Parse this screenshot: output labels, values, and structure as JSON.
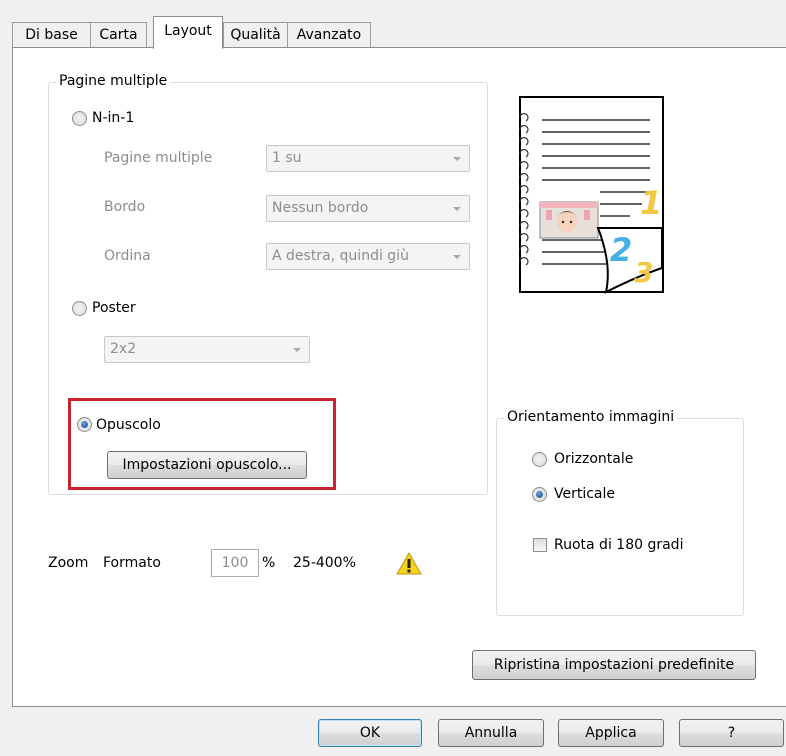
{
  "tabs": [
    "Di base",
    "Carta",
    "Layout",
    "Qualità",
    "Avanzato"
  ],
  "active_tab": "Layout",
  "pagine_multiple": {
    "legend": "Pagine multiple",
    "nin1": {
      "label": "N-in-1",
      "checked": false,
      "pagine_label": "Pagine multiple",
      "pagine_value": "1 su",
      "bordo_label": "Bordo",
      "bordo_value": "Nessun bordo",
      "ordina_label": "Ordina",
      "ordina_value": "A destra, quindi giù"
    },
    "poster": {
      "label": "Poster",
      "checked": false,
      "value": "2x2"
    },
    "opuscolo": {
      "label": "Opuscolo",
      "checked": true,
      "button": "Impostazioni opuscolo...",
      "highlight_color": "#c8232c"
    }
  },
  "orientamento": {
    "legend": "Orientamento immagini",
    "orizzontale": {
      "label": "Orizzontale",
      "checked": false
    },
    "verticale": {
      "label": "Verticale",
      "checked": true
    },
    "ruota": {
      "label": "Ruota di 180 gradi",
      "checked": false
    }
  },
  "zoom": {
    "label": "Zoom",
    "formato_label": "Formato",
    "value": "100",
    "unit": "%",
    "range": "25-400%"
  },
  "preview": {
    "page_numbers": [
      "1",
      "2",
      "3"
    ]
  },
  "ripristina_button": "Ripristina impostazioni predefinite",
  "footer": {
    "ok": "OK",
    "annulla": "Annulla",
    "applica": "Applica",
    "help": "?"
  }
}
